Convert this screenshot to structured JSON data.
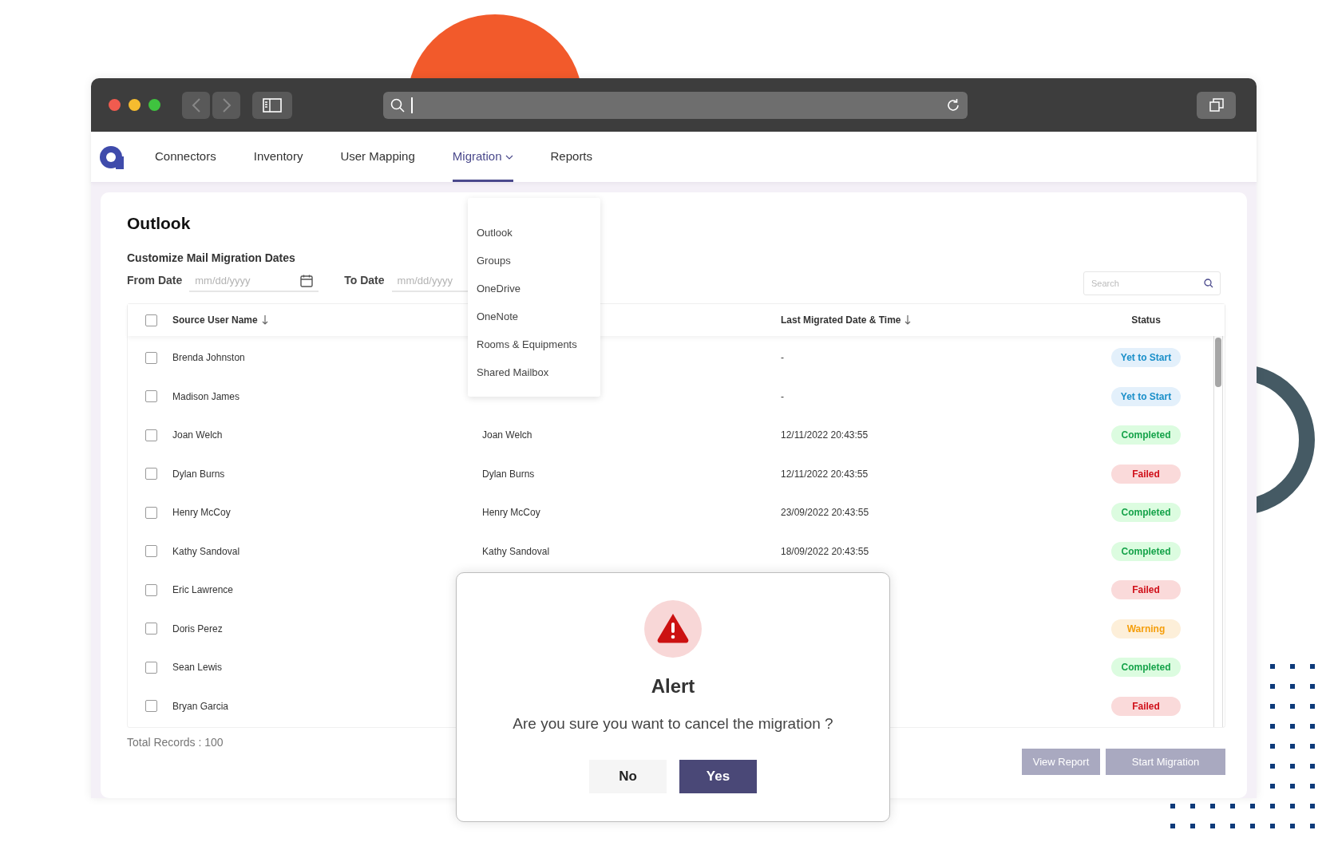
{
  "nav": {
    "tabs": [
      {
        "label": "Connectors",
        "selected": false,
        "has_menu": false
      },
      {
        "label": "Inventory",
        "selected": false,
        "has_menu": false
      },
      {
        "label": "User Mapping",
        "selected": false,
        "has_menu": false
      },
      {
        "label": "Migration",
        "selected": true,
        "has_menu": true
      },
      {
        "label": "Reports",
        "selected": false,
        "has_menu": false
      }
    ]
  },
  "migration_menu": {
    "items": [
      "Outlook",
      "Groups",
      "OneDrive",
      "OneNote",
      "Rooms & Equipments",
      "Shared Mailbox"
    ]
  },
  "page": {
    "title": "Outlook",
    "dates_heading": "Customize Mail Migration Dates",
    "from_label": "From Date",
    "from_placeholder": "mm/dd/yyyy",
    "to_label": "To Date",
    "to_placeholder": "mm/dd/yyyy",
    "search_placeholder": "Search"
  },
  "table": {
    "all_checked": false,
    "source_column": {
      "label": "Source User Name",
      "sorted": true
    },
    "date_column": {
      "label": "Last Migrated Date & Time",
      "sorted": true
    },
    "status_column": {
      "label": "Status"
    },
    "rows": [
      {
        "checked": false,
        "source": "Brenda Johnston",
        "date": "-",
        "status": {
          "label": "Yet to Start",
          "kind": "pending"
        }
      },
      {
        "checked": false,
        "source": "Madison James",
        "date": "-",
        "status": {
          "label": "Yet to Start",
          "kind": "pending"
        }
      },
      {
        "checked": false,
        "source": "Joan Welch",
        "column_2": "Joan Welch",
        "date": "12/11/2022 20:43:55",
        "status": {
          "label": "Completed",
          "kind": "success"
        }
      },
      {
        "checked": false,
        "source": "Dylan Burns",
        "column_2": "Dylan Burns",
        "date": "12/11/2022 20:43:55",
        "status": {
          "label": "Failed",
          "kind": "failed"
        }
      },
      {
        "checked": false,
        "source": "Henry McCoy",
        "column_2": "Henry McCoy",
        "date": "23/09/2022 20:43:55",
        "status": {
          "label": "Completed",
          "kind": "success"
        }
      },
      {
        "checked": false,
        "source": "Kathy Sandoval",
        "column_2": "Kathy Sandoval",
        "date": "18/09/2022 20:43:55",
        "status": {
          "label": "Completed",
          "kind": "success"
        }
      },
      {
        "checked": false,
        "source": "Eric Lawrence",
        "status": {
          "label": "Failed",
          "kind": "failed"
        }
      },
      {
        "checked": false,
        "source": "Doris Perez",
        "status": {
          "label": "Warning",
          "kind": "warning"
        }
      },
      {
        "checked": false,
        "source": "Sean Lewis",
        "status": {
          "label": "Completed",
          "kind": "success"
        }
      },
      {
        "checked": false,
        "source": "Bryan Garcia",
        "status": {
          "label": "Failed",
          "kind": "failed"
        }
      }
    ],
    "total_records": "Total Records : 100"
  },
  "actions": [
    {
      "label": "View Report",
      "disabled": true
    },
    {
      "label": "Start Migration",
      "disabled": true
    }
  ],
  "alert": {
    "title": "Alert",
    "message": "Are you sure you want to cancel the migration ?",
    "buttons": [
      {
        "label": "No",
        "kind": "secondary"
      },
      {
        "label": "Yes",
        "kind": "primary"
      }
    ]
  }
}
